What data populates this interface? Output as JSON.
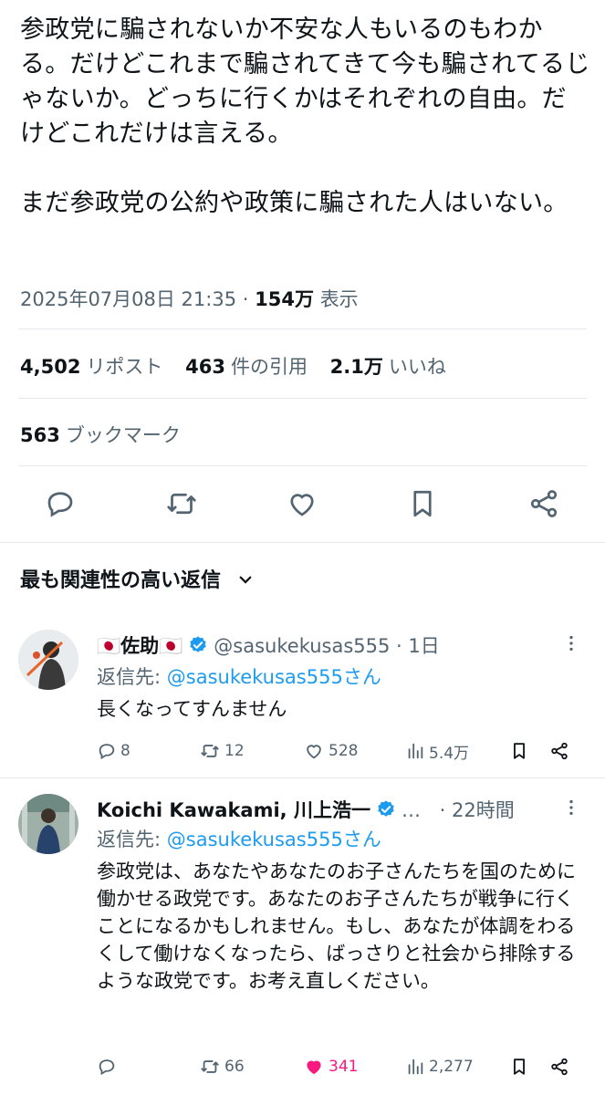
{
  "tweet": {
    "text": "参政党に騙されないか不安な人もいるのもわかる。だけどこれまで騙されてきて今も騙されてるじゃないか。どっちに行くかはそれぞれの自由。だけどこれだけは言える。\n\nまだ参政党の公約や政策に騙された人はいない。",
    "datetime": "2025年07月08日 21:35",
    "separator": "·",
    "views_count": "154万",
    "views_label": "表示",
    "reposts_count": "4,502",
    "reposts_label": "リポスト",
    "quotes_count": "463",
    "quotes_label": "件の引用",
    "likes_count": "2.1万",
    "likes_label": "いいね",
    "bookmarks_count": "563",
    "bookmarks_label": "ブックマーク"
  },
  "colors": {
    "accent": "#1d9bf0",
    "like": "#f91880",
    "muted": "#536471",
    "text": "#0f1419",
    "divider": "#e6e9ec"
  },
  "replies_header": "最も関連性の高い返信",
  "replies": [
    {
      "name": "🇯🇵佐助🇯🇵",
      "handle": "@sasukekusas555",
      "time": "· 1日",
      "reply_to_label": "返信先: ",
      "reply_to_handle": "@sasukekusas555さん",
      "text": "長くなってすんません",
      "stats": {
        "replies": "8",
        "reposts": "12",
        "likes": "528",
        "views": "5.4万"
      },
      "liked": false
    },
    {
      "name": "Koichi Kawakami, 川上浩一",
      "handle": "…",
      "time": "· 22時間",
      "reply_to_label": "返信先: ",
      "reply_to_handle": "@sasukekusas555さん",
      "text": "参政党は、あなたやあなたのお子さんたちを国のために働かせる政党です。あなたのお子さんたちが戦争に行くことになるかもしれません。もし、あなたが体調をわるくして働けなくなったら、ばっさりと社会から排除するような政党です。お考え直しください。",
      "stats": {
        "replies": "",
        "reposts": "66",
        "likes": "341",
        "views": "2,277"
      },
      "liked": true
    }
  ]
}
